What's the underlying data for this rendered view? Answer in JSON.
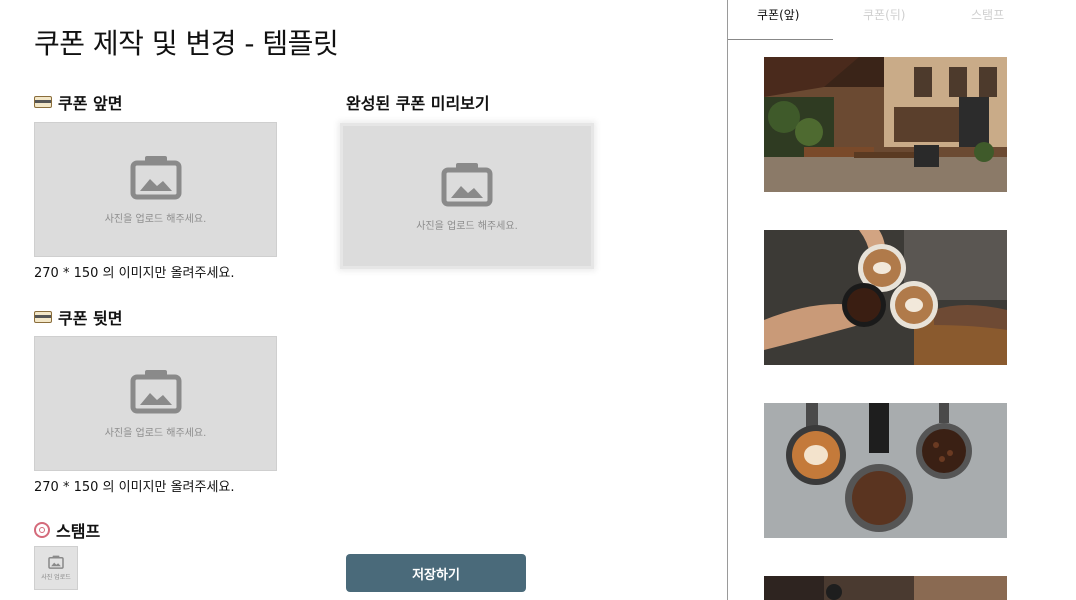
{
  "page": {
    "title": "쿠폰 제작 및 변경 - 템플릿"
  },
  "sections": {
    "front": {
      "label": "쿠폰 앞면",
      "upload_text": "사진을 업로드 해주세요.",
      "hint": "270 * 150 의 이미지만 올려주세요."
    },
    "back": {
      "label": "쿠폰 뒷면",
      "upload_text": "사진을 업로드 해주세요.",
      "hint": "270 * 150 의 이미지만 올려주세요."
    },
    "stamp": {
      "label": "스탬프",
      "upload_text": "사진 업로드"
    },
    "preview": {
      "label": "완성된 쿠폰 미리보기",
      "upload_text": "사진을 업로드 해주세요."
    }
  },
  "actions": {
    "save_label": "저장하기"
  },
  "sidebar": {
    "tabs": [
      {
        "label": "쿠폰(앞)",
        "active": true
      },
      {
        "label": "쿠폰(뒤)",
        "active": false
      },
      {
        "label": "스탬프",
        "active": false
      }
    ],
    "templates": [
      "cafe-street-photo",
      "latte-cheers-photo",
      "coffee-portafilter-photo",
      "cafe-interior-photo"
    ]
  },
  "colors": {
    "button": "#4a6a7a",
    "placeholder": "#dcdcdc",
    "placeholder_text": "#8d8d8d"
  }
}
